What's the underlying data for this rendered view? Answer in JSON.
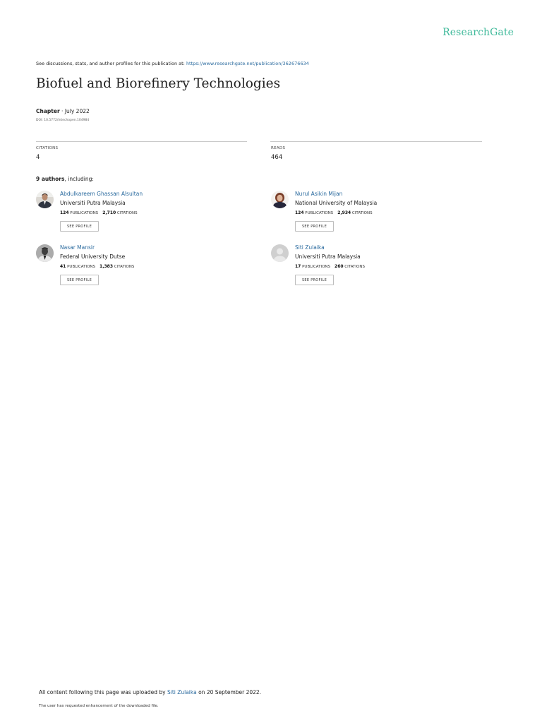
{
  "brand": {
    "logo_text": "ResearchGate",
    "logo_color": "#40ba9b",
    "link_color": "#2a6a9e"
  },
  "header": {
    "see_text": "See discussions, stats, and author profiles for this publication at:",
    "see_url": "https://www.researchgate.net/publication/362676634"
  },
  "publication": {
    "title": "Biofuel and Biorefinery Technologies",
    "type": "Chapter",
    "separator": " · ",
    "date": "July 2022",
    "doi": "DOI: 10.5772/intechopen.104984"
  },
  "stats": {
    "citations_label": "CITATIONS",
    "citations_value": "4",
    "reads_label": "READS",
    "reads_value": "464"
  },
  "authors_heading": {
    "count": "9 authors",
    "suffix": ", including:"
  },
  "authors": [
    {
      "name": "Abdulkareem Ghassan Alsultan",
      "institution": "Universiti Putra Malaysia",
      "publications": "124",
      "publications_label": "PUBLICATIONS",
      "citations": "2,710",
      "citations_label": "CITATIONS",
      "button": "SEE PROFILE",
      "avatar_icon": "person-photo-icon"
    },
    {
      "name": "Nurul Asikin Mijan",
      "institution": "National University of Malaysia",
      "publications": "124",
      "publications_label": "PUBLICATIONS",
      "citations": "2,934",
      "citations_label": "CITATIONS",
      "button": "SEE PROFILE",
      "avatar_icon": "person-photo-icon"
    },
    {
      "name": "Nasar Mansir",
      "institution": "Federal University Dutse",
      "publications": "41",
      "publications_label": "PUBLICATIONS",
      "citations": "1,383",
      "citations_label": "CITATIONS",
      "button": "SEE PROFILE",
      "avatar_icon": "person-photo-icon"
    },
    {
      "name": "Siti Zulaika",
      "institution": "Universiti Putra Malaysia",
      "publications": "17",
      "publications_label": "PUBLICATIONS",
      "citations": "260",
      "citations_label": "CITATIONS",
      "button": "SEE PROFILE",
      "avatar_icon": "default-avatar-icon"
    }
  ],
  "footer": {
    "uploaded_prefix": "All content following this page was uploaded by",
    "uploader": "Siti Zulaika",
    "uploaded_suffix": "on 20 September 2022.",
    "note": "The user has requested enhancement of the downloaded file."
  }
}
